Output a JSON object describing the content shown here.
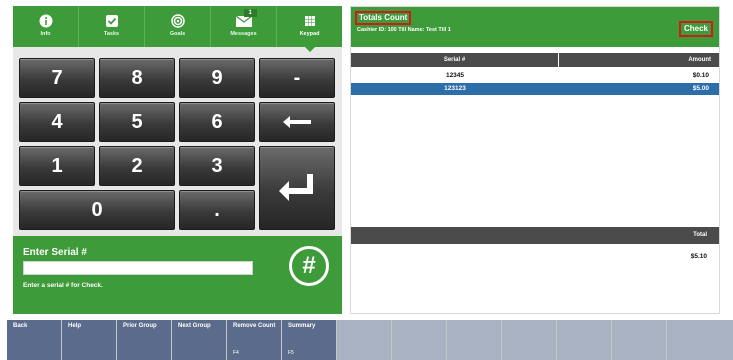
{
  "nav": [
    {
      "label": "Info",
      "icon": "info-icon"
    },
    {
      "label": "Tasks",
      "icon": "tasks-icon"
    },
    {
      "label": "Goals",
      "icon": "goals-icon"
    },
    {
      "label": "Messages",
      "icon": "messages-icon",
      "badge": "1"
    },
    {
      "label": "Keypad",
      "icon": "keypad-icon",
      "active": true
    }
  ],
  "keypad": {
    "k7": "7",
    "k8": "8",
    "k9": "9",
    "minus": "-",
    "k4": "4",
    "k5": "5",
    "k6": "6",
    "k1": "1",
    "k2": "2",
    "k3": "3",
    "k0": "0",
    "dot": "."
  },
  "serial": {
    "title": "Enter Serial #",
    "value": "",
    "hint": "Enter a serial # for Check.",
    "hash": "#"
  },
  "totals": {
    "title": "Totals Count",
    "cashier_info": "Cashier ID:  100   Till Name:  Test Till 1",
    "check_label": "Check",
    "col_serial": "Serial #",
    "col_amount": "Amount",
    "rows": [
      {
        "serial": "12345",
        "amount": "$0.10"
      },
      {
        "serial": "123123",
        "amount": "$5.00"
      }
    ],
    "total_label": "Total",
    "total_value": "$5.10"
  },
  "fbar": [
    {
      "label": "Back",
      "key": ""
    },
    {
      "label": "Help",
      "key": ""
    },
    {
      "label": "Prior Group",
      "key": ""
    },
    {
      "label": "Next Group",
      "key": ""
    },
    {
      "label": "Remove Count",
      "key": "F4"
    },
    {
      "label": "Summary",
      "key": "F5"
    },
    {
      "label": "",
      "key": ""
    },
    {
      "label": "",
      "key": ""
    },
    {
      "label": "",
      "key": ""
    },
    {
      "label": "",
      "key": ""
    },
    {
      "label": "",
      "key": ""
    },
    {
      "label": "",
      "key": ""
    },
    {
      "label": "",
      "key": ""
    }
  ],
  "colors": {
    "green": "#3d9b3a",
    "dark_gray": "#4b4b4b",
    "selected_row": "#2e6ea8",
    "highlight_red": "#d11a1a",
    "fkey_dark": "#5b6b8c",
    "fkey_light": "#a9b2c3"
  }
}
